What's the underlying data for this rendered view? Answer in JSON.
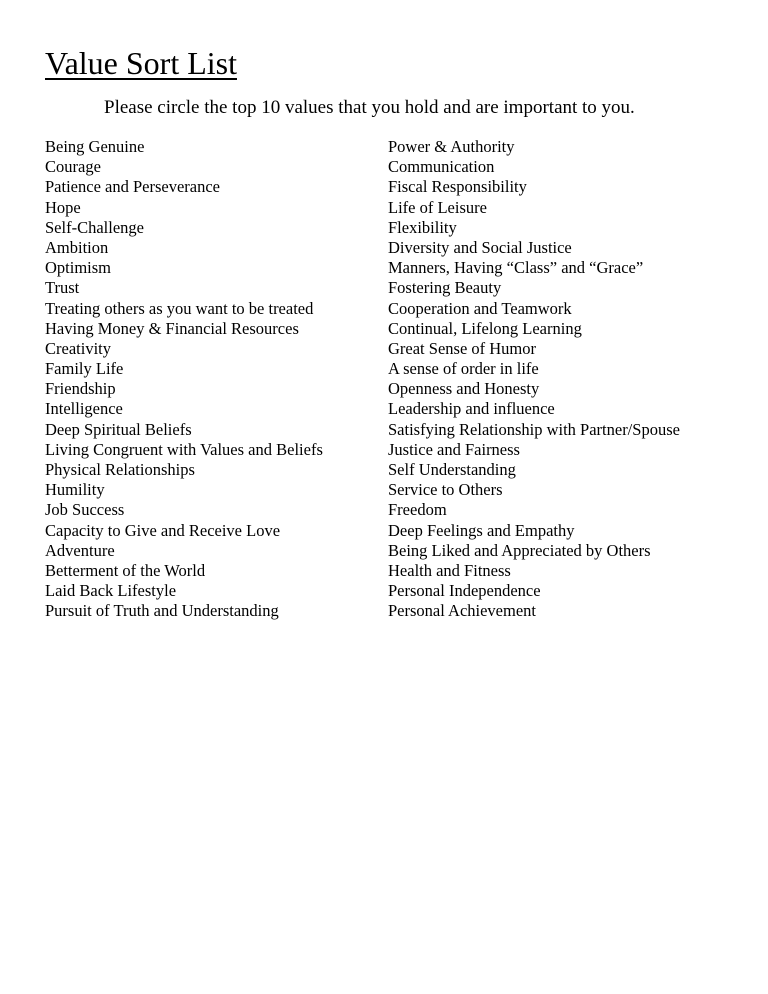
{
  "document": {
    "title": "Value Sort List",
    "instructions": "Please circle the top 10 values that you hold and are important to you."
  },
  "values": {
    "left_column": [
      "Being Genuine",
      "Courage",
      "Patience and Perseverance",
      "Hope",
      "Self-Challenge",
      "Ambition",
      "Optimism",
      "Trust",
      "Treating others as you want to be treated",
      "Having Money & Financial Resources",
      "Creativity",
      "Family Life",
      "Friendship",
      "Intelligence",
      "Deep Spiritual Beliefs",
      "Living Congruent with Values and Beliefs",
      "Physical Relationships",
      "Humility",
      "Job Success",
      "Capacity to Give and Receive Love",
      "Adventure",
      "Betterment of the World",
      "Laid Back Lifestyle",
      "Pursuit of Truth and Understanding"
    ],
    "right_column": [
      "Power & Authority",
      "Communication",
      "Fiscal Responsibility",
      "Life of Leisure",
      "Flexibility",
      "Diversity and Social Justice",
      "Manners, Having “Class” and “Grace”",
      "Fostering Beauty",
      "Cooperation and Teamwork",
      "Continual, Lifelong Learning",
      "Great Sense of Humor",
      "A sense of order in life",
      "Openness and Honesty",
      "Leadership and influence",
      "Satisfying Relationship with Partner/Spouse",
      "Justice and Fairness",
      "Self Understanding",
      "Service to Others",
      "Freedom",
      "Deep Feelings and Empathy",
      "Being Liked and Appreciated by Others",
      "Health and Fitness",
      "Personal Independence",
      "Personal Achievement"
    ]
  }
}
